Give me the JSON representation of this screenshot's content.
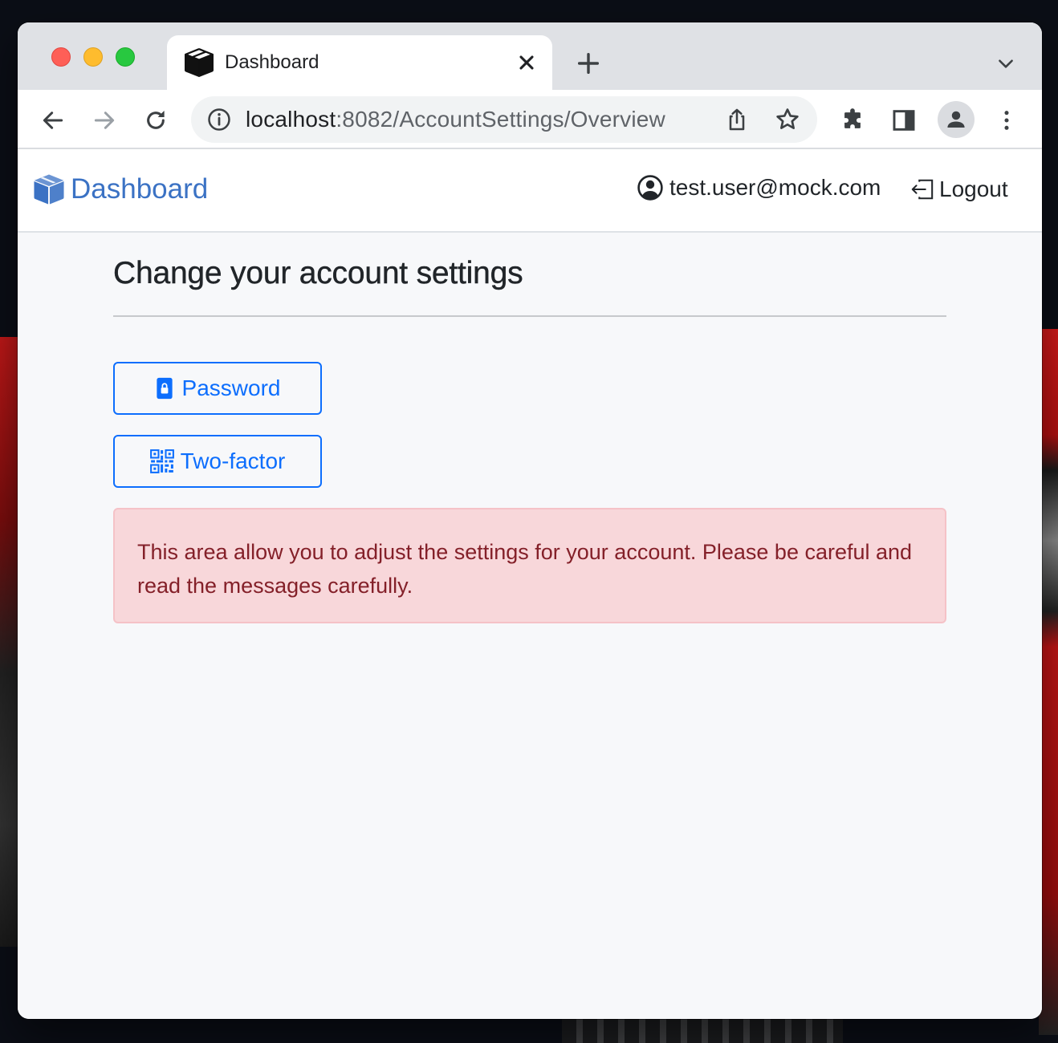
{
  "browser": {
    "tab_title": "Dashboard",
    "url_host": "localhost",
    "url_rest": ":8082/AccountSettings/Overview"
  },
  "navbar": {
    "brand": "Dashboard",
    "user_email": "test.user@mock.com",
    "logout_label": "Logout"
  },
  "main": {
    "heading": "Change your account settings",
    "buttons": {
      "password": "Password",
      "two_factor": "Two-factor"
    },
    "alert_text": "This area allow you to adjust the settings for your account. Please be careful and read the messages carefully."
  },
  "icons": {
    "tab": "box-icon",
    "brand": "box-icon",
    "user": "person-circle-icon",
    "logout": "box-arrow-left-icon",
    "password": "lock-icon",
    "two_factor": "qr-code-icon"
  },
  "colors": {
    "brand": "#3b72c4",
    "primary": "#0d6efd",
    "alert_bg": "#f8d7da",
    "alert_text": "#842029"
  }
}
